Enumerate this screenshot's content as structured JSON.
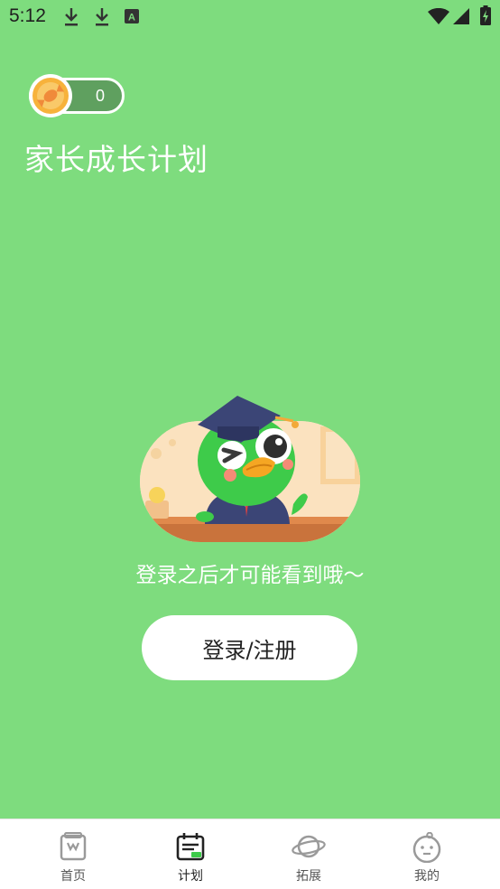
{
  "status_bar": {
    "time": "5:12",
    "icons": [
      "download-icon",
      "download-icon",
      "font-icon",
      "wifi-icon",
      "signal-icon",
      "battery-charging-icon"
    ]
  },
  "header": {
    "coin_count": "0",
    "title": "家长成长计划"
  },
  "main": {
    "hint": "登录之后才可能看到哦～",
    "login_button_label": "登录/注册"
  },
  "bottom_nav": {
    "items": [
      {
        "label": "首页",
        "icon": "home-book-icon",
        "active": false
      },
      {
        "label": "计划",
        "icon": "plan-calendar-icon",
        "active": true
      },
      {
        "label": "拓展",
        "icon": "planet-icon",
        "active": false
      },
      {
        "label": "我的",
        "icon": "profile-face-icon",
        "active": false
      }
    ]
  },
  "colors": {
    "background": "#7edc7e",
    "coin_pill": "#5fa05f",
    "coin": "#f7b23b",
    "mascot": "#3ecb4a",
    "nav_active_accent": "#3ecb4a"
  }
}
